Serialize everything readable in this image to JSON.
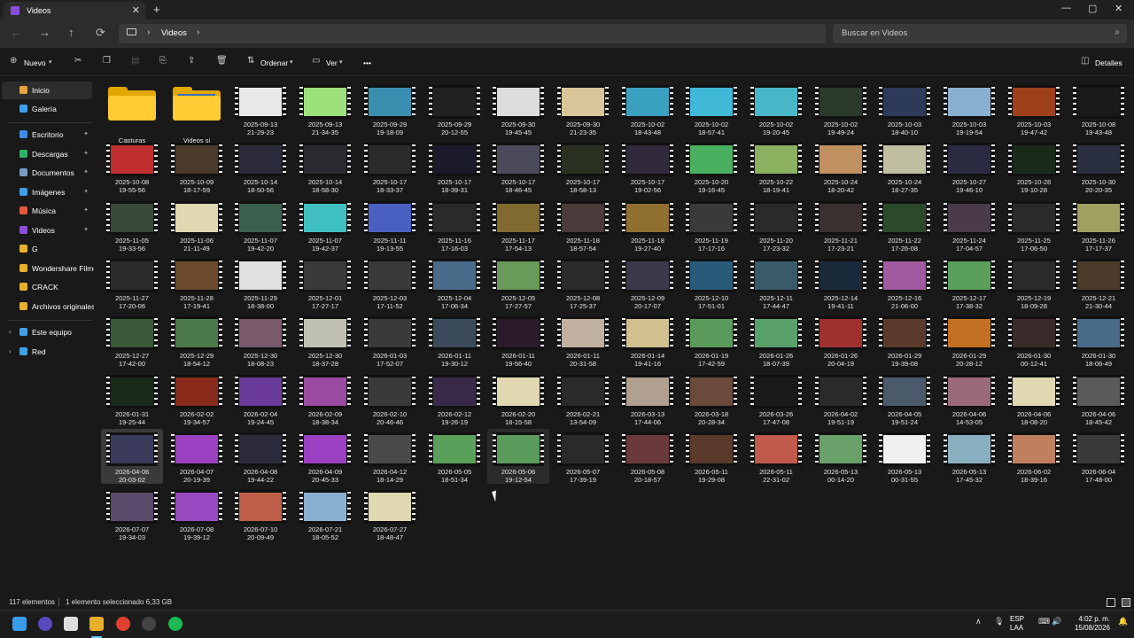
{
  "window": {
    "tab_title": "Videos",
    "new_tab": "+",
    "minimize": "—",
    "maximize": "▢",
    "close": "✕"
  },
  "nav": {
    "back": "←",
    "forward": "→",
    "up": "↑",
    "refresh": "⟳",
    "breadcrumb": "Videos",
    "breadcrumb_sep": "›",
    "search_placeholder": "Buscar en Videos"
  },
  "toolbar": {
    "new": "Nuevo",
    "sort": "Ordenar",
    "view": "Ver",
    "more": "•••",
    "details": "Detalles"
  },
  "sidebar": {
    "top": [
      {
        "label": "Inicio",
        "color": "#e8a33c",
        "active": true
      },
      {
        "label": "Galería",
        "color": "#3fa0e8",
        "active": false
      }
    ],
    "pinned": [
      {
        "label": "Escritorio",
        "color": "#3c8ce8"
      },
      {
        "label": "Descargas",
        "color": "#2fb36b"
      },
      {
        "label": "Documentos",
        "color": "#7a9bbf"
      },
      {
        "label": "Imágenes",
        "color": "#3fa0e8"
      },
      {
        "label": "Música",
        "color": "#e8573c"
      },
      {
        "label": "Videos",
        "color": "#8a4de0"
      }
    ],
    "folders": [
      {
        "label": "G"
      },
      {
        "label": "Wondershare Filmora"
      },
      {
        "label": "CRACK"
      },
      {
        "label": "Archivos originales"
      }
    ],
    "bottom": [
      {
        "label": "Este equipo",
        "color": "#3fa0e8"
      },
      {
        "label": "Red",
        "color": "#3fa0e8"
      }
    ],
    "pin_glyph": "📌",
    "chev": "›"
  },
  "folders": [
    {
      "name": "Capturas"
    },
    {
      "name": "Videos si"
    }
  ],
  "videos": [
    {
      "d": "2025-09-13",
      "t": "21-29-23",
      "c": "#e8e8e8"
    },
    {
      "d": "2025-09-13",
      "t": "21-34-35",
      "c": "#9be07a"
    },
    {
      "d": "2025-09-29",
      "t": "19-18-09",
      "c": "#3a8fb0"
    },
    {
      "d": "2025-09-29",
      "t": "20-12-55",
      "c": "#222"
    },
    {
      "d": "2025-09-30",
      "t": "19-45-45",
      "c": "#ddd"
    },
    {
      "d": "2025-09-30",
      "t": "21-23-35",
      "c": "#d9c59a"
    },
    {
      "d": "2025-10-02",
      "t": "18-43-48",
      "c": "#3aa0c0"
    },
    {
      "d": "2025-10-02",
      "t": "18-57-41",
      "c": "#40b8d8"
    },
    {
      "d": "2025-10-02",
      "t": "19-20-45",
      "c": "#48b8c8"
    },
    {
      "d": "2025-10-02",
      "t": "19-49-24",
      "c": "#2a3a2a"
    },
    {
      "d": "2025-10-03",
      "t": "18-40-10",
      "c": "#2e3a5a"
    },
    {
      "d": "2025-10-03",
      "t": "19-19-54",
      "c": "#8ab0d0"
    },
    {
      "d": "2025-10-03",
      "t": "19-47-42",
      "c": "#a0401a"
    },
    {
      "d": "2025-10-08",
      "t": "19-43-48",
      "c": "#1a1a1a"
    },
    {
      "d": "2025-10-08",
      "t": "19-55-56",
      "c": "#c03030"
    },
    {
      "d": "2025-10-09",
      "t": "18-17-59",
      "c": "#4a3a2a"
    },
    {
      "d": "2025-10-14",
      "t": "18-50-56",
      "c": "#2a2a3a"
    },
    {
      "d": "2025-10-14",
      "t": "18-58-30",
      "c": "#2a2a30"
    },
    {
      "d": "2025-10-17",
      "t": "18-33-37",
      "c": "#2a2a2a"
    },
    {
      "d": "2025-10-17",
      "t": "18-39-31",
      "c": "#1a1a2a"
    },
    {
      "d": "2025-10-17",
      "t": "18-46-45",
      "c": "#4a4a5a"
    },
    {
      "d": "2025-10-17",
      "t": "18-58-13",
      "c": "#2a3020"
    },
    {
      "d": "2025-10-17",
      "t": "19-02-56",
      "c": "#302a3a"
    },
    {
      "d": "2025-10-20",
      "t": "19-16-45",
      "c": "#4ab060"
    },
    {
      "d": "2025-10-22",
      "t": "18-19-41",
      "c": "#8ab060"
    },
    {
      "d": "2025-10-24",
      "t": "18-20-42",
      "c": "#c09060"
    },
    {
      "d": "2025-10-24",
      "t": "18-27-35",
      "c": "#c0c0a0"
    },
    {
      "d": "2025-10-27",
      "t": "19-46-10",
      "c": "#2a2a40"
    },
    {
      "d": "2025-10-28",
      "t": "19-10-28",
      "c": "#1a2a1a"
    },
    {
      "d": "2025-10-30",
      "t": "20-20-35",
      "c": "#2a3040"
    },
    {
      "d": "2025-11-05",
      "t": "19-33-56",
      "c": "#3a4a3a"
    },
    {
      "d": "2025-11-06",
      "t": "21-11-49",
      "c": "#e0d8b0"
    },
    {
      "d": "2025-11-07",
      "t": "19-42-20",
      "c": "#3a6050"
    },
    {
      "d": "2025-11-07",
      "t": "19-42-37",
      "c": "#40c0c0"
    },
    {
      "d": "2025-11-11",
      "t": "19-13-55",
      "c": "#4a60c0"
    },
    {
      "d": "2025-11-16",
      "t": "17-16-03",
      "c": "#2a2a2a"
    },
    {
      "d": "2025-11-17",
      "t": "17-54-13",
      "c": "#806a30"
    },
    {
      "d": "2025-11-18",
      "t": "18-57-54",
      "c": "#4a3a3a"
    },
    {
      "d": "2025-11-18",
      "t": "19-27-40",
      "c": "#907030"
    },
    {
      "d": "2025-11-19",
      "t": "17-17-16",
      "c": "#3a3a3a"
    },
    {
      "d": "2025-11-20",
      "t": "17-23-32",
      "c": "#2a2a2a"
    },
    {
      "d": "2025-11-21",
      "t": "17-23-21",
      "c": "#3a3030"
    },
    {
      "d": "2025-11-22",
      "t": "17-26-08",
      "c": "#2a4a2a"
    },
    {
      "d": "2025-11-24",
      "t": "17-04-57",
      "c": "#4a3a4a"
    },
    {
      "d": "2025-11-25",
      "t": "17-06-50",
      "c": "#2a2a2a"
    },
    {
      "d": "2025-11-26",
      "t": "17-17-37",
      "c": "#a0a060"
    },
    {
      "d": "2025-11-27",
      "t": "17-20-06",
      "c": "#2a2a2a"
    },
    {
      "d": "2025-11-28",
      "t": "17-19-41",
      "c": "#6a4a2a"
    },
    {
      "d": "2025-11-29",
      "t": "18-38-00",
      "c": "#e0e0e0"
    },
    {
      "d": "2025-12-01",
      "t": "17-27-17",
      "c": "#3a3a3a"
    },
    {
      "d": "2025-12-03",
      "t": "17-11-52",
      "c": "#3a3a3a"
    },
    {
      "d": "2025-12-04",
      "t": "17-06-34",
      "c": "#4a6a8a"
    },
    {
      "d": "2025-12-05",
      "t": "17-27-57",
      "c": "#6a9a5a"
    },
    {
      "d": "2025-12-08",
      "t": "17-25-37",
      "c": "#2a2a2a"
    },
    {
      "d": "2025-12-09",
      "t": "20-17-07",
      "c": "#3a3a4a"
    },
    {
      "d": "2025-12-10",
      "t": "17-51-01",
      "c": "#2a5a7a"
    },
    {
      "d": "2025-12-11",
      "t": "17-44-47",
      "c": "#3a5a6a"
    },
    {
      "d": "2025-12-14",
      "t": "19-41-11",
      "c": "#1a2a3a"
    },
    {
      "d": "2025-12-16",
      "t": "21-06-00",
      "c": "#a05aa0"
    },
    {
      "d": "2025-12-17",
      "t": "17-38-32",
      "c": "#5aa05a"
    },
    {
      "d": "2025-12-19",
      "t": "18-09-28",
      "c": "#2a2a2a"
    },
    {
      "d": "2025-12-21",
      "t": "21-30-44",
      "c": "#4a3a2a"
    },
    {
      "d": "2025-12-27",
      "t": "17-42-00",
      "c": "#3a5a3a"
    },
    {
      "d": "2025-12-29",
      "t": "18-54-12",
      "c": "#4a7a4a"
    },
    {
      "d": "2025-12-30",
      "t": "18-08-23",
      "c": "#7a5a6a"
    },
    {
      "d": "2025-12-30",
      "t": "18-37-28",
      "c": "#c0c0b0"
    },
    {
      "d": "2026-01-03",
      "t": "17-52-07",
      "c": "#3a3a3a"
    },
    {
      "d": "2026-01-11",
      "t": "19-30-12",
      "c": "#3a4a5a"
    },
    {
      "d": "2026-01-11",
      "t": "19-56-40",
      "c": "#2a1a2a"
    },
    {
      "d": "2026-01-11",
      "t": "20-31-58",
      "c": "#c0b0a0"
    },
    {
      "d": "2026-01-14",
      "t": "19-41-16",
      "c": "#d0c090"
    },
    {
      "d": "2026-01-19",
      "t": "17-42-59",
      "c": "#5a9a5a"
    },
    {
      "d": "2026-01-26",
      "t": "18-07-39",
      "c": "#5aa06a"
    },
    {
      "d": "2026-01-26",
      "t": "20-04-19",
      "c": "#a03030"
    },
    {
      "d": "2026-01-29",
      "t": "19-39-08",
      "c": "#5a3a2a"
    },
    {
      "d": "2026-01-29",
      "t": "20-28-12",
      "c": "#c07020"
    },
    {
      "d": "2026-01-30",
      "t": "00-12-41",
      "c": "#3a2a2a"
    },
    {
      "d": "2026-01-30",
      "t": "18-06-49",
      "c": "#4a6a8a"
    },
    {
      "d": "2026-01-31",
      "t": "19-25-44",
      "c": "#1a2a1a"
    },
    {
      "d": "2026-02-02",
      "t": "19-34-57",
      "c": "#8a2a1a"
    },
    {
      "d": "2026-02-04",
      "t": "19-24-45",
      "c": "#6a3a9a"
    },
    {
      "d": "2026-02-09",
      "t": "18-38-34",
      "c": "#9a4aa0"
    },
    {
      "d": "2026-02-10",
      "t": "20-46-46",
      "c": "#3a3a3a"
    },
    {
      "d": "2026-02-12",
      "t": "19-26-19",
      "c": "#3a2a4a"
    },
    {
      "d": "2026-02-20",
      "t": "18-15-58",
      "c": "#e0d8b0"
    },
    {
      "d": "2026-02-21",
      "t": "13-54-09",
      "c": "#2a2a2a"
    },
    {
      "d": "2026-03-13",
      "t": "17-44-06",
      "c": "#b0a090"
    },
    {
      "d": "2026-03-18",
      "t": "20-28-34",
      "c": "#6a4a3a"
    },
    {
      "d": "2026-03-26",
      "t": "17-47-08",
      "c": "#1a1a1a"
    },
    {
      "d": "2026-04-02",
      "t": "19-51-19",
      "c": "#2a2a2a"
    },
    {
      "d": "2026-04-05",
      "t": "19-51-24",
      "c": "#4a5a6a"
    },
    {
      "d": "2026-04-06",
      "t": "14-53-05",
      "c": "#9a6a7a"
    },
    {
      "d": "2026-04-06",
      "t": "18-08-20",
      "c": "#e0d8b0"
    },
    {
      "d": "2026-04-06",
      "t": "18-45-42",
      "c": "#5a5a5a"
    },
    {
      "d": "2026-04-06",
      "t": "20-03-02",
      "c": "#3a3a5a"
    },
    {
      "d": "2026-04-07",
      "t": "20-19-39",
      "c": "#9a40c0"
    },
    {
      "d": "2026-04-08",
      "t": "19-44-22",
      "c": "#2a2a3a"
    },
    {
      "d": "2026-04-09",
      "t": "20-45-33",
      "c": "#9a40c0"
    },
    {
      "d": "2026-04-12",
      "t": "18-14-29",
      "c": "#4a4a4a"
    },
    {
      "d": "2026-05-05",
      "t": "18-51-34",
      "c": "#5aa05a"
    },
    {
      "d": "2026-05-06",
      "t": "19-12-54",
      "c": "#5a9a5a"
    },
    {
      "d": "2026-05-07",
      "t": "17-39-19",
      "c": "#2a2a2a"
    },
    {
      "d": "2026-05-08",
      "t": "20-18-57",
      "c": "#6a3a3a"
    },
    {
      "d": "2026-05-11",
      "t": "19-29-08",
      "c": "#5a3a2a"
    },
    {
      "d": "2026-05-11",
      "t": "22-31-02",
      "c": "#c05a4a"
    },
    {
      "d": "2026-05-13",
      "t": "00-14-20",
      "c": "#6aa06a"
    },
    {
      "d": "2026-05-13",
      "t": "00-31-55",
      "c": "#f0f0f0"
    },
    {
      "d": "2026-05-13",
      "t": "17-45-32",
      "c": "#8ab0c0"
    },
    {
      "d": "2026-06-02",
      "t": "18-39-16",
      "c": "#c08060"
    },
    {
      "d": "2026-06-04",
      "t": "17-48-00",
      "c": "#3a3a3a"
    },
    {
      "d": "2026-07-07",
      "t": "19-34-03",
      "c": "#5a4a6a"
    },
    {
      "d": "2026-07-08",
      "t": "19-39-12",
      "c": "#9a4ac0"
    },
    {
      "d": "2026-07-10",
      "t": "20-09-49",
      "c": "#c0604a"
    },
    {
      "d": "2026-07-21",
      "t": "18-05-52",
      "c": "#8ab0d0"
    },
    {
      "d": "2026-07-27",
      "t": "18-48-47",
      "c": "#e0d8b0"
    }
  ],
  "status": {
    "count": "117 elementos",
    "selection": "1 elemento seleccionado  6,33 GB"
  },
  "taskbar": {
    "lang": "ESP",
    "lang2": "LAA",
    "time": "4:02 p. m.",
    "date": "15/08/2026",
    "chevron": "∧"
  },
  "colors": {
    "accent": "#60cdff",
    "folder": "#ffcc33"
  }
}
